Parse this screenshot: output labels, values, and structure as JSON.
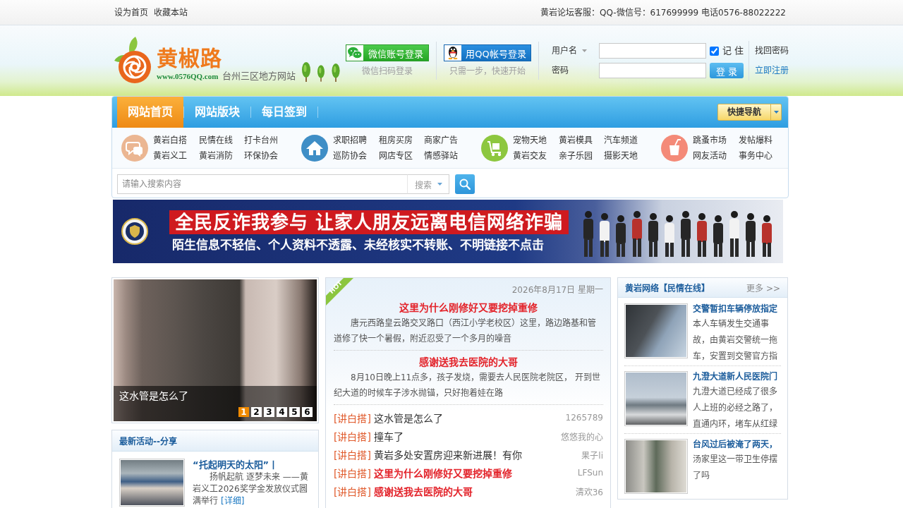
{
  "top_bar": {
    "links": [
      "设为首页",
      "收藏本站"
    ],
    "contact": "黄岩论坛客服：QQ-微信号：617699999 电话0576-88022222"
  },
  "header": {
    "logo": {
      "name": "黄椒路",
      "url": "www.0576QQ.com",
      "tagline": "台州三区地方网站"
    },
    "social_logins": [
      {
        "kind": "wechat",
        "label": "微信账号登录",
        "hint": "微信扫码登录"
      },
      {
        "kind": "qq",
        "label": "用QQ帐号登录",
        "hint": "只需一步，快速开始"
      }
    ],
    "login": {
      "username_label": "用户名",
      "password_label": "密码",
      "remember": {
        "label": "记 住",
        "checked": true
      },
      "submit": "登 录",
      "forgot": "找回密码",
      "register": "立即注册"
    }
  },
  "nav": {
    "tabs": [
      {
        "label": "网站首页",
        "selected": true
      },
      {
        "label": "网站版块",
        "selected": false
      },
      {
        "label": "每日签到",
        "selected": false
      }
    ],
    "quick_nav": "快捷导航"
  },
  "categories": [
    {
      "kind": "chat",
      "links": [
        "黄岩白搭",
        "民情在线",
        "打卡台州",
        "黄岩义工",
        "黄岩消防",
        "环保协会"
      ]
    },
    {
      "kind": "home",
      "links": [
        "求职招聘",
        "租房买房",
        "商家广告",
        "巡防协会",
        "网店专区",
        "情感驿站"
      ]
    },
    {
      "kind": "cart",
      "links": [
        "宠物天地",
        "黄岩模具",
        "汽车频道",
        "黄岩交友",
        "亲子乐园",
        "摄影天地"
      ]
    },
    {
      "kind": "cup",
      "links": [
        "跳蚤市场",
        "发帖爆料",
        "网友活动",
        "事务中心"
      ]
    }
  ],
  "search": {
    "placeholder": "请输入搜索内容",
    "scope": "搜索"
  },
  "banner": {
    "headline": "全民反诈我参与 让家人朋友远离电信网络诈骗",
    "slogan": "陌生信息**不**轻信、个人资料**不**透露、未经核实**不**转账、不明链接**不**点击"
  },
  "slideshow": {
    "caption": "这水管是怎么了",
    "pages": [
      {
        "label": "1",
        "selected": true
      },
      {
        "label": "2",
        "selected": false
      },
      {
        "label": "3",
        "selected": false
      },
      {
        "label": "4",
        "selected": false
      },
      {
        "label": "5",
        "selected": false
      },
      {
        "label": "6",
        "selected": false
      }
    ]
  },
  "activity_panel": {
    "title": "最新活动--分享",
    "items": [
      {
        "title": "“托起明天的太阳”丨",
        "summary": "扬帆起航 逐梦未来 ——黄岩义工2026奖学金发放仪式圆满举行",
        "more": "[详细]"
      }
    ]
  },
  "news_panel": {
    "badge": "HOT",
    "date": "2026年8月17日 星期一",
    "featured": [
      {
        "title": "这里为什么刚修好又要挖掉重修",
        "summary": "唐元西路皇云路交叉路口（西江小学老校区）这里，路边路基和管道修了快一个暑假，附近忍受了一个多月的噪音"
      },
      {
        "title": "感谢送我去医院的大哥",
        "summary": "8月10日晚上11点多，孩子发烧，需要去人民医院老院区， 开到世纪大道的时候车子涉水抛锚，只好抱着娃在路"
      }
    ],
    "posts": [
      {
        "tag": "[讲白搭]",
        "title": "这水管是怎么了",
        "author": "1265789",
        "highlighted": false
      },
      {
        "tag": "[讲白搭]",
        "title": "撞车了",
        "author": "悠悠我的心",
        "highlighted": false
      },
      {
        "tag": "[讲白搭]",
        "title": "黄岩多处安置房迎来新进展！有你",
        "author": "果子li",
        "highlighted": false
      },
      {
        "tag": "[讲白搭]",
        "title": "这里为什么刚修好又要挖掉重修",
        "author": "LFSun",
        "highlighted": true
      },
      {
        "tag": "[讲白搭]",
        "title": "感谢送我去医院的大哥",
        "author": "清欢36",
        "highlighted": true
      }
    ]
  },
  "side_panel": {
    "title": "黄岩网络【民情在线】",
    "more": "更多 >>",
    "items": [
      {
        "title": "交警暂扣车辆停放指定",
        "summary": "本人车辆发生交通事故，由黄岩交警统一拖车，安置到交警官方指"
      },
      {
        "title": "九澄大道新人民医院门",
        "summary": "九澄大道已经成了很多人上班的必经之路了，直通内环，堵车从红绿"
      },
      {
        "title": "台风过后被淹了两天，",
        "summary": "汤家里这一带卫生停摆了吗"
      }
    ]
  }
}
